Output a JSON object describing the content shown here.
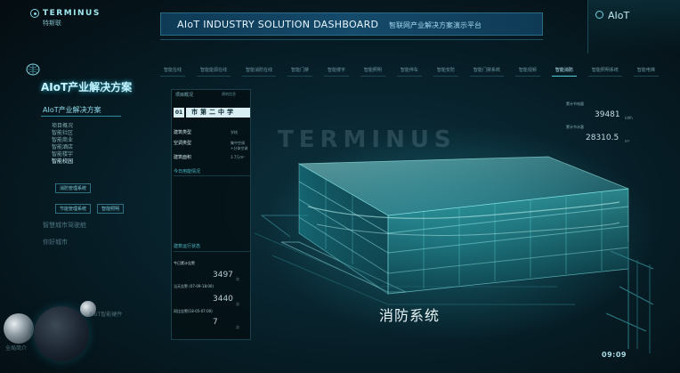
{
  "brand": {
    "name": "TERMINUS",
    "cn_name": "特斯联",
    "logo_icon": "terminus-logo-icon"
  },
  "header": {
    "title_en": "AIoT  INDUSTRY SOLUTION DASHBOARD",
    "title_cn": "智联网产业解决方案演示平台"
  },
  "corner": {
    "title": "AIoT"
  },
  "tabs": [
    "智能在线",
    "智能能源在线",
    "智能消防在线",
    "智能门禁",
    "智能楼宇",
    "智能照明",
    "智能停车",
    "智能安防",
    "智能门禁系统",
    "智能视频",
    "智能消防",
    "智能照明系统",
    "智能电梯"
  ],
  "left_nav": {
    "title": "AIoT产业解决方案",
    "subtitle": "AIoT产业解决方案",
    "items": [
      "项目概况",
      "智能社区",
      "智能商业",
      "智能酒店",
      "智能楼宇",
      "智能校园"
    ],
    "active_index": 5,
    "sub_buttons": [
      "消防管理系统",
      "节能管理系统",
      "智能照明"
    ],
    "extra_items": [
      "智慧城市驾驶舱",
      "你好城市",
      "AIoT智能硬件",
      "全局简介"
    ]
  },
  "info_panel": {
    "title": "项目概况",
    "corner_note": "建筑信息",
    "number": "01",
    "school": "市第二中学",
    "rows": [
      {
        "label": "建筑类型",
        "value": "学校"
      },
      {
        "label": "空调类型",
        "value": "集中空调+分体空调"
      },
      {
        "label": "建筑面积",
        "value": "3.7万m²"
      }
    ],
    "section1": "今日用能情况",
    "section2": "建筑运行状态",
    "stats_title": "今日累计告警",
    "stats": [
      {
        "label": "今日累计告警",
        "value": "3497",
        "unit": "次"
      },
      {
        "label": "当天告警 (07-09-18:00)",
        "value": "3440",
        "unit": "次"
      },
      {
        "label": "同比告警(18-05-07:00)",
        "value": "7",
        "unit": "次"
      }
    ]
  },
  "right_stats": [
    {
      "label": "累计节电量",
      "value": "39481",
      "unit": "kWh"
    },
    {
      "label": "累计节水量",
      "value": "28310.5",
      "unit": "m³"
    }
  ],
  "watermark": "TERMINUS",
  "caption": "消防系统",
  "time": "09:09",
  "colors": {
    "accent": "#4fc9dc",
    "background": "#06141a",
    "building": "#35c8cf"
  }
}
